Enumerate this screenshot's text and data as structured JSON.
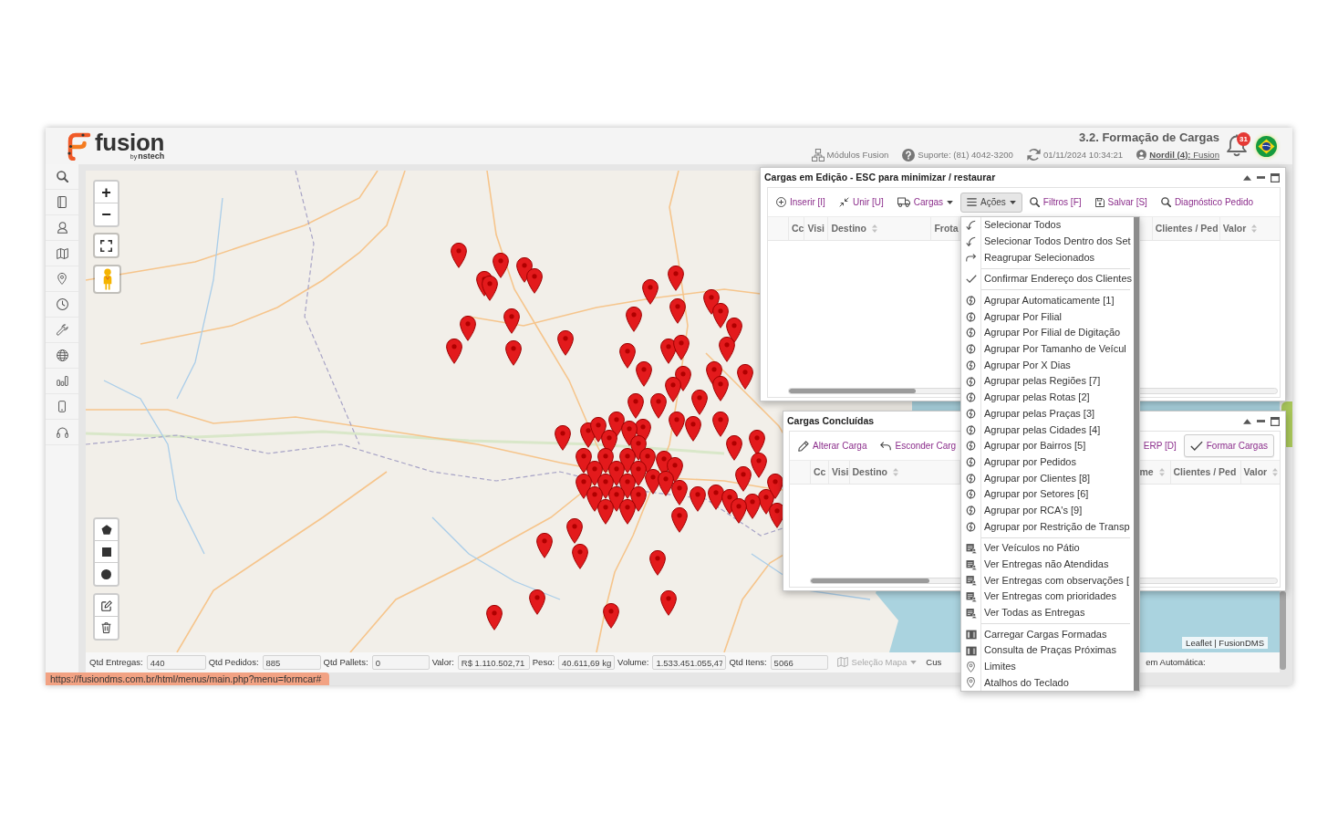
{
  "header": {
    "logo_text": "fusion",
    "logo_byline_prefix": "by",
    "logo_byline": "nstech",
    "page_title": "3.2. Formação de Cargas",
    "info": [
      {
        "kind": "modules",
        "text": "Módulos Fusion"
      },
      {
        "kind": "support",
        "text": "Suporte: (81) 4042-3200"
      },
      {
        "kind": "refresh",
        "text": "01/11/2024 10:34:21"
      },
      {
        "kind": "user",
        "text": "**Nordil (4):** Fusion"
      }
    ],
    "notifications": "31"
  },
  "map": {
    "zoom_in": "+",
    "zoom_out": "−",
    "attribution_link": "Leaflet",
    "attribution_text": "| FusionDMS"
  },
  "panels": [
    {
      "title": "Cargas em Edição - ESC para minimizar / restaurar",
      "toolbar": [
        {
          "kind": "link",
          "label": "Inserir [I]",
          "expanded": false
        },
        {
          "kind": "link",
          "label": "Unir [U]",
          "expanded": false
        },
        {
          "kind": "dropdown",
          "label": "Cargas",
          "expanded": false
        },
        {
          "kind": "dropdown",
          "label": "Ações",
          "expanded": true
        },
        {
          "kind": "link",
          "label": "Filtros [F]",
          "expanded": false
        },
        {
          "kind": "link",
          "label": "Salvar [S]",
          "expanded": false
        },
        {
          "kind": "link",
          "label": "Diagnóstico Pedido",
          "expanded": false
        }
      ],
      "columns": [
        {
          "label": "Cc",
          "sortable": false
        },
        {
          "label": "Visi",
          "sortable": false
        },
        {
          "label": "Destino",
          "sortable": true
        },
        {
          "label": "Frota",
          "sortable": false
        },
        {
          "label": "Clientes / Ped",
          "sortable": false
        },
        {
          "label": "Valor",
          "sortable": true
        }
      ]
    },
    {
      "title": "Cargas Concluídas",
      "toolbar": [
        {
          "kind": "link",
          "label": "Alterar Carga",
          "expanded": false
        },
        {
          "kind": "link",
          "label": "Esconder Carg",
          "expanded": false
        },
        {
          "kind": "link",
          "label": "ERP [D]",
          "expanded": false
        },
        {
          "kind": "outlined",
          "label": "Formar Cargas",
          "expanded": false
        }
      ],
      "columns": [
        {
          "label": "Cc",
          "sortable": false
        },
        {
          "label": "Visi",
          "sortable": false
        },
        {
          "label": "Destino",
          "sortable": true
        },
        {
          "label": "me",
          "sortable": true
        },
        {
          "label": "Clientes / Ped",
          "sortable": false
        },
        {
          "label": "Valor",
          "sortable": true
        }
      ]
    }
  ],
  "actions_menu": {
    "sections": [
      {
        "items": [
          {
            "kind": "select",
            "label": "Selecionar Todos"
          },
          {
            "kind": "select",
            "label": "Selecionar Todos Dentro dos Set"
          },
          {
            "kind": "regroup",
            "label": "Reagrupar Selecionados"
          }
        ]
      },
      {
        "items": [
          {
            "kind": "confirm",
            "label": "Confirmar Endereço dos Clientes"
          }
        ]
      },
      {
        "items": [
          {
            "kind": "group",
            "label": "Agrupar Automaticamente [1]"
          },
          {
            "kind": "group",
            "label": "Agrupar Por Filial"
          },
          {
            "kind": "group",
            "label": "Agrupar Por Filial de Digitação"
          },
          {
            "kind": "group",
            "label": "Agrupar Por Tamanho de Veícul"
          },
          {
            "kind": "group",
            "label": "Agrupar Por X Dias"
          },
          {
            "kind": "group",
            "label": "Agrupar pelas Regiões [7]"
          },
          {
            "kind": "group",
            "label": "Agrupar pelas Rotas [2]"
          },
          {
            "kind": "group",
            "label": "Agrupar pelas Praças [3]"
          },
          {
            "kind": "group",
            "label": "Agrupar pelas Cidades [4]"
          },
          {
            "kind": "group",
            "label": "Agrupar por Bairros [5]"
          },
          {
            "kind": "group",
            "label": "Agrupar por Pedidos"
          },
          {
            "kind": "group",
            "label": "Agrupar por Clientes [8]"
          },
          {
            "kind": "group",
            "label": "Agrupar por Setores [6]"
          },
          {
            "kind": "group",
            "label": "Agrupar por RCA's [9]"
          },
          {
            "kind": "group",
            "label": "Agrupar por Restrição de Transp"
          }
        ]
      },
      {
        "items": [
          {
            "kind": "view",
            "label": "Ver Veículos no Pátio"
          },
          {
            "kind": "view",
            "label": "Ver Entregas não Atendidas"
          },
          {
            "kind": "view",
            "label": "Ver Entregas com observações ["
          },
          {
            "kind": "view",
            "label": "Ver Entregas com prioridades"
          },
          {
            "kind": "view",
            "label": "Ver Todas as Entregas"
          }
        ]
      },
      {
        "items": [
          {
            "kind": "load",
            "label": "Carregar Cargas Formadas"
          },
          {
            "kind": "load",
            "label": "Consulta de Praças Próximas"
          },
          {
            "kind": "limits",
            "label": "Limites"
          },
          {
            "kind": "limits",
            "label": "Atalhos do Teclado"
          }
        ]
      }
    ]
  },
  "bottom_bar": {
    "stats": [
      {
        "label": "Qtd Entregas:",
        "value": "440"
      },
      {
        "label": "Qtd Pedidos:",
        "value": "885"
      },
      {
        "label": "Qtd Pallets:",
        "value": "0"
      },
      {
        "label": "Valor:",
        "value": "R$ 1.110.502,71"
      },
      {
        "label": "Peso:",
        "value": "40.611,69 kg"
      },
      {
        "label": "Volume:",
        "value": "1.533.451.055,47"
      },
      {
        "label": "Qtd Itens:",
        "value": "5066"
      }
    ],
    "map_selection": {
      "label": "Seleção Mapa",
      "disabled": true
    },
    "partial_label_1": "Cus",
    "partial_label_2": "em Automática:"
  },
  "status_url": "https://fusiondms.com.br/html/menus/main.php?menu=formcar#"
}
